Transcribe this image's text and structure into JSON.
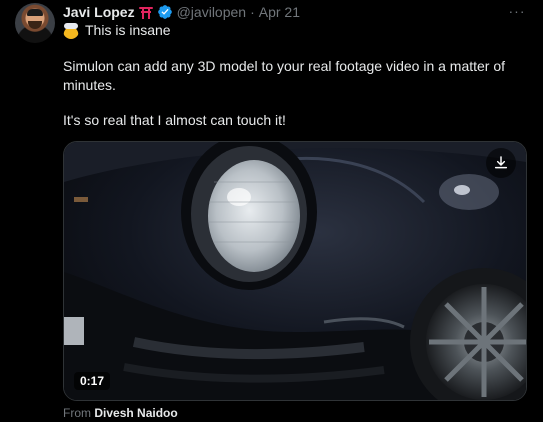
{
  "author": {
    "name": "Javi Lopez",
    "handle": "@javilopen",
    "separator": "·",
    "date": "Apr 21",
    "avatar_icon": "avatar-photo",
    "badges": [
      "torii-gate-emoji",
      "verified-badge-icon"
    ]
  },
  "more_label": "···",
  "post": {
    "line1": "This is insane",
    "line1_emoji": "exploding-head-emoji",
    "paragraph2": "Simulon can add any 3D model to your real footage video in a matter of minutes.",
    "paragraph3": "It's so real that I almost can touch it!"
  },
  "media": {
    "duration": "0:17",
    "download_icon": "download-icon",
    "from_label": "From",
    "from_author": "Divesh Naidoo"
  },
  "colors": {
    "background": "#000000",
    "text_primary": "#e7e9ea",
    "text_secondary": "#71767b",
    "verified": "#1d9bf0",
    "torii": "#e0245e"
  }
}
